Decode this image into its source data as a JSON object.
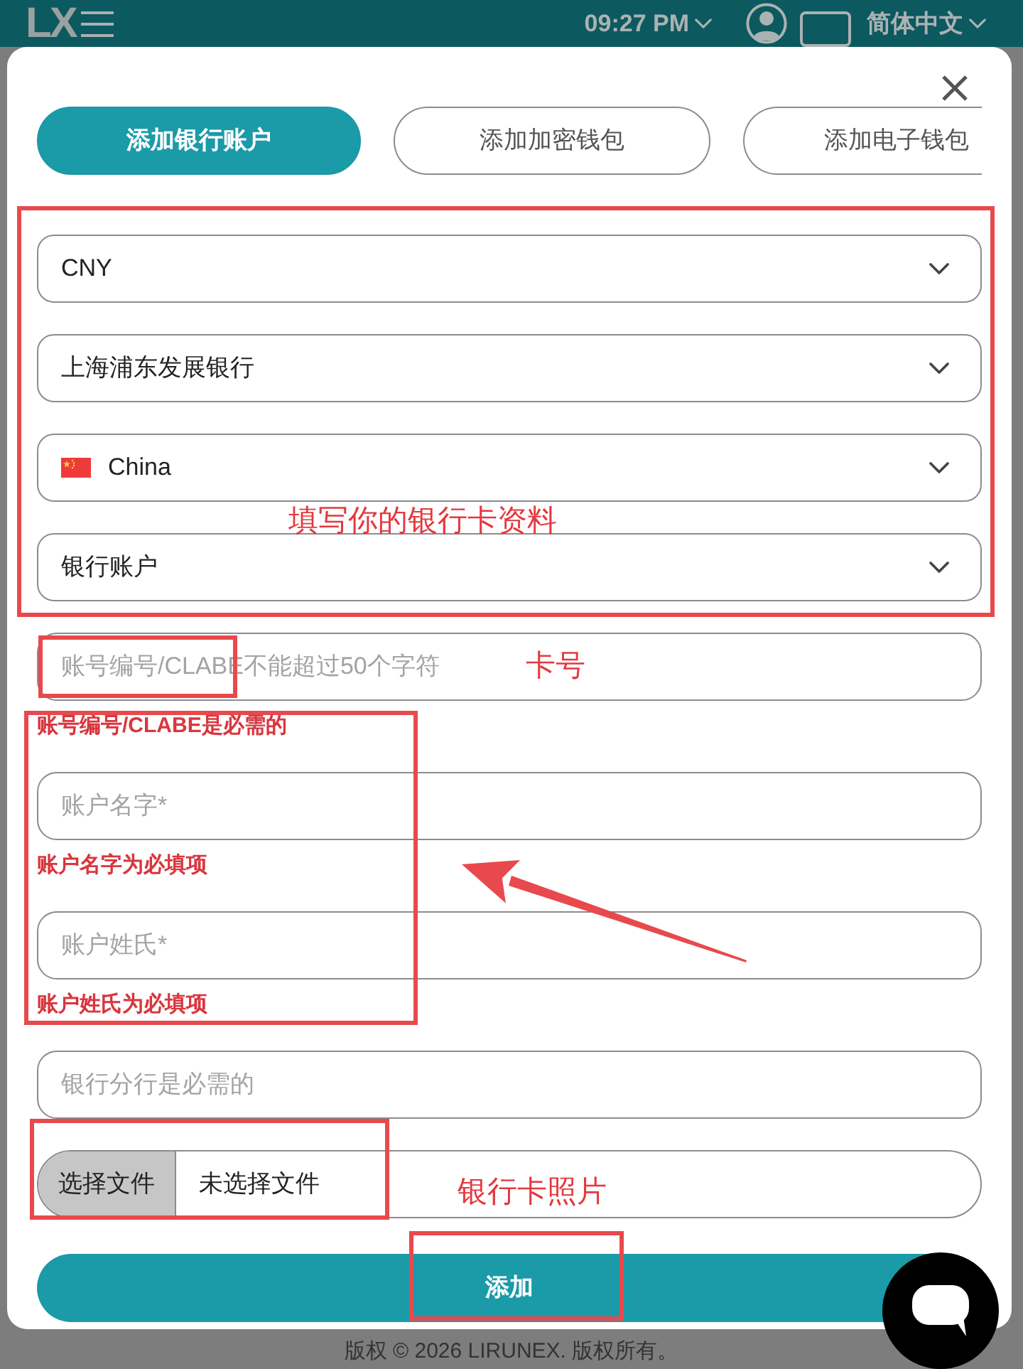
{
  "header": {
    "logo": "LX",
    "time": "09:27 PM",
    "language": "简体中文"
  },
  "dialog": {
    "tabs": [
      {
        "label": "添加银行账户",
        "selected": true
      },
      {
        "label": "添加加密钱包",
        "selected": false
      },
      {
        "label": "添加电子钱包",
        "selected": false
      }
    ],
    "fields": [
      {
        "kind": "select",
        "value": "CNY"
      },
      {
        "kind": "select",
        "value": "上海浦东发展银行"
      },
      {
        "kind": "country-select",
        "value": "China"
      },
      {
        "kind": "select",
        "value": "银行账户"
      },
      {
        "kind": "input",
        "placeholder": "账号编号/CLABE不能超过50个字符",
        "error": "账号编号/CLABE是必需的"
      },
      {
        "kind": "input",
        "placeholder": "账户名字*",
        "error": "账户名字为必填项"
      },
      {
        "kind": "input",
        "placeholder": "账户姓氏*",
        "error": "账户姓氏为必填项"
      },
      {
        "kind": "input",
        "placeholder": "银行分行是必需的"
      },
      {
        "kind": "file",
        "button": "选择文件",
        "value": "未选择文件"
      }
    ],
    "submit": "添加"
  },
  "footer": {
    "copyright": "版权 © 2026 LIRUNEX. 版权所有。"
  },
  "annotations": [
    {
      "text": "填写你的银行卡资料"
    },
    {
      "text": "卡号"
    },
    {
      "text": "银行卡照片"
    }
  ]
}
